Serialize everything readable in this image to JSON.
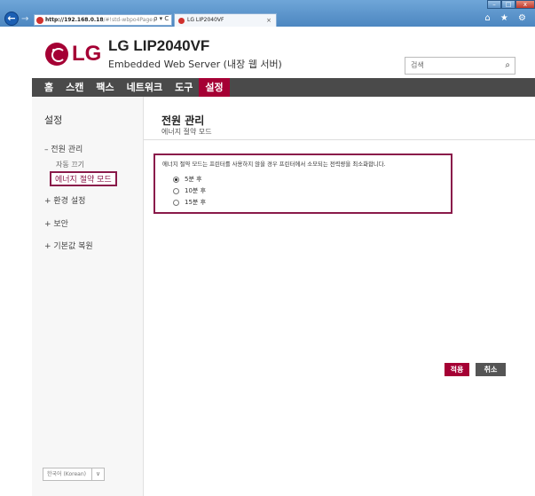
{
  "browser": {
    "back_label": "←",
    "forward_label": "→",
    "address_host": "http://192.168.0.18",
    "address_rest": "/#!std-wbpo4Page",
    "address_tools": "ρ ▾ C",
    "tab_title": "LG LIP2040VF",
    "tab_close": "×",
    "window_min": "–",
    "window_max": "□",
    "window_close": "x",
    "toolbar_icons": "⌂ ★ ⚙"
  },
  "header": {
    "brand": "LG",
    "model": "LG LIP2040VF",
    "subtitle": "Embedded Web Server (내장 웹 서버)",
    "search_placeholder": "검색",
    "search_icon": "⌕"
  },
  "menu": {
    "items": [
      {
        "label": "홈"
      },
      {
        "label": "스캔"
      },
      {
        "label": "팩스"
      },
      {
        "label": "네트워크"
      },
      {
        "label": "도구"
      },
      {
        "label": "설정"
      }
    ],
    "active_index": 5
  },
  "sidebar": {
    "title": "설정",
    "power_group": "– 전원 관리",
    "power_off": "자동 끄기",
    "energy_saving": "에너지 절약 모드",
    "environment": "+ 환경 설정",
    "security": "+ 보안",
    "factory_reset": "+ 기본값 복원",
    "language": "한국어 (Korean)",
    "language_dropdown": "∨"
  },
  "main": {
    "title": "전원 관리",
    "subtitle": "에너지 절약 모드",
    "description": "에너지 절약 모드는 프린터를 사용하지 않을 경우 프린터에서 소모되는 전력량을 최소화합니다.",
    "options": [
      {
        "label": "5분 후",
        "selected": true
      },
      {
        "label": "10분 후",
        "selected": false
      },
      {
        "label": "15분 후",
        "selected": false
      }
    ],
    "apply_label": "적용",
    "cancel_label": "취소"
  },
  "colors": {
    "brand": "#a50034",
    "menubar": "#4a4a4a",
    "highlight_border": "#8a1a4a"
  }
}
